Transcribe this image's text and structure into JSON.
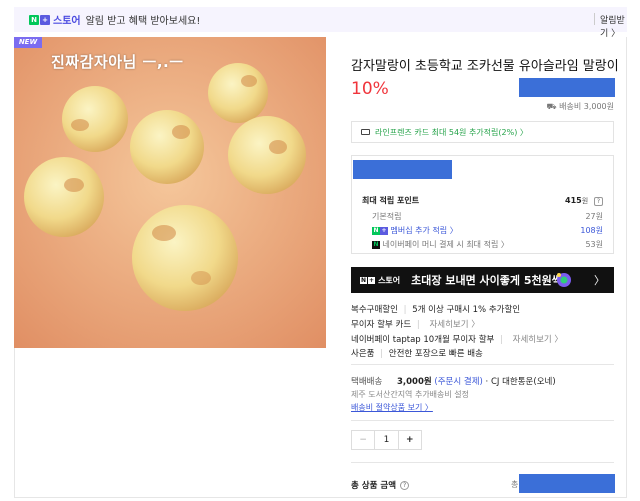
{
  "banner": {
    "badge_n": "N",
    "badge_plus": "+",
    "store_label": "스토어",
    "message": "알림 받고 혜택 받아보세요!",
    "alarm_label": "알림받기 〉"
  },
  "product": {
    "new_tag": "NEW",
    "image_caption": "진짜감자아님 ㅡ,.ㅡ",
    "title": "감자말랑이 초등학교 조카선물 유아슬라임 말랑이",
    "discount": "10%",
    "shipping_fee": "배송비 3,000원"
  },
  "card_benefit": {
    "text": "라인프렌즈 카드 최대 54원 추가적립(2%) 〉"
  },
  "points": {
    "max_label": "최대 적립 포인트",
    "max_amount": "415",
    "unit": "원",
    "help": "?",
    "rows": [
      {
        "label": "기본적립",
        "amount": "27원"
      },
      {
        "label": "멤버십 추가 적립 〉",
        "amount": "108원"
      },
      {
        "label": "네이버페이 머니 결제 시 최대 적립 〉",
        "amount": "53원"
      }
    ]
  },
  "store_banner": {
    "logo_n": "N",
    "logo_plus": "+",
    "logo_store": "스토어",
    "text": "초대장 보내면 사이좋게 5천원씩",
    "chevron": "〉"
  },
  "benefits": {
    "multi_discount_label": "복수구매할인",
    "multi_discount_text": "5개 이상 구매시 1% 추가할인",
    "installment_label": "무이자 할부 카드",
    "installment_link": "자세히보기 〉",
    "naverpay_label": "네이버페이 taptap 10개월 무이자 할부",
    "naverpay_link": "자세히보기 〉",
    "gift_label": "사은품",
    "gift_text": "안전한 포장으로 빠른 배송"
  },
  "delivery": {
    "label": "택배배송",
    "price": "3,000원",
    "payment": "(주문시 결제)",
    "carrier": "· CJ 대한통운(오네)",
    "note": "제주 도서산간지역 추가배송비 설정",
    "link": "배송비 절약상품 보기 〉"
  },
  "quantity": {
    "minus": "−",
    "value": "1",
    "plus": "+"
  },
  "total": {
    "label": "총 상품 금액",
    "help": "?",
    "prefix": "총"
  },
  "colors": {
    "accent_purple": "#5b5be0",
    "naver_green": "#03c75a",
    "discount_red": "#f0353c",
    "redaction_blue": "#3b6fd8"
  }
}
